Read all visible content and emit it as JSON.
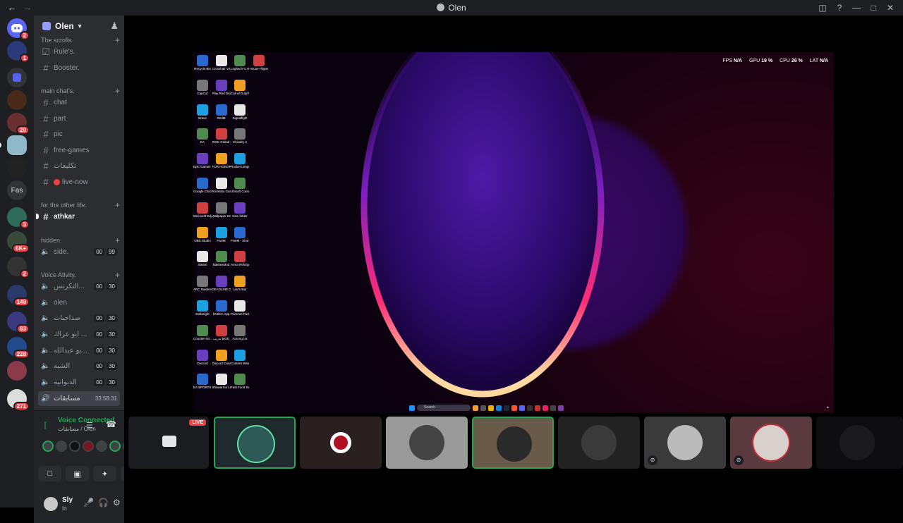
{
  "window": {
    "title": "Olen",
    "back_icon": "←",
    "forward_icon": "→"
  },
  "rail": {
    "badges": {
      "home": "2",
      "s1": "1",
      "s3": "20",
      "s6": "3",
      "s7": "6K+",
      "s8": "2",
      "s9": "149",
      "s10": "83",
      "s11": "228",
      "s12": "271"
    },
    "text_server": "Fas"
  },
  "server": {
    "name": "Olen",
    "categories": {
      "scrolls": "The scrolls.",
      "main": "main chat's.",
      "other": "for the other life.",
      "hidden": "hidden.",
      "voice": "Voice Ativity."
    },
    "channels": {
      "rules": "Rule's.",
      "booster": "Booster.",
      "chat": "chat",
      "part": "part",
      "pic": "pic",
      "free_games": "free-games",
      "takhelat": "تكليفات",
      "live_now": "live-now",
      "athkar": "athkar",
      "side": "side.",
      "v1": "التكرنس...",
      "olen": "olen",
      "v3": "صداجبات",
      "v4": "ابو عراك ...",
      "v5": "بو عبدالله...",
      "v6": "الشبه",
      "v7": "الدبوانية",
      "v8": "مسابقات"
    },
    "counts": {
      "side_a": "00",
      "side_b": "99",
      "a": "00",
      "b": "30"
    },
    "active_timer": "33:58:31"
  },
  "voice": {
    "title": "Voice Connected",
    "subtitle": "مسابقات / Olen"
  },
  "user": {
    "name": "Sly",
    "status": "In"
  },
  "stream": {
    "hud": {
      "fps_label": "FPS",
      "fps": "N/A",
      "gpu_label": "GPU",
      "gpu": "19 %",
      "cpu_label": "CPU",
      "cpu": "26 %",
      "lat_label": "LAT",
      "lat": "N/A"
    },
    "desktop_icons": [
      "Recycle Bin",
      "Crosshair V2",
      "Logitech G HUB",
      "House Flipper",
      "CapCut",
      "Play Red Dead Rede...",
      "Call of Duty®",
      "Brave",
      "RedM",
      "Signalfight",
      "EA",
      "RISK Global Domination",
      "Chivalry 2",
      "Epic Games Launcher",
      "FOR HONOR",
      "Rocket League®",
      "Google Chrome",
      "Rockstar Games...",
      "Ubisoft Connect",
      "Microsoft Edge",
      "Wallpaper Engine",
      "New folder",
      "OBS Studio",
      "FiveM",
      "FiveM - Shortcut",
      "Steam",
      "BakkesMod",
      "Arma Reforger",
      "ARC Raiders",
      "DEADLINE DELIVER...",
      "Liar's Bar",
      "Deltaright",
      "NVIDIA App",
      "Pummel Party",
      "Counter-Str... 2",
      "تدريب MOD",
      "Among Us",
      "Discord",
      "Discord Canary",
      "Content Warning",
      "EA SPORTS FC™ 26",
      "Shawarma Legend",
      "Fast Food Simulator"
    ],
    "taskbar_search": "Search"
  },
  "tiles": {
    "live": "LIVE"
  }
}
